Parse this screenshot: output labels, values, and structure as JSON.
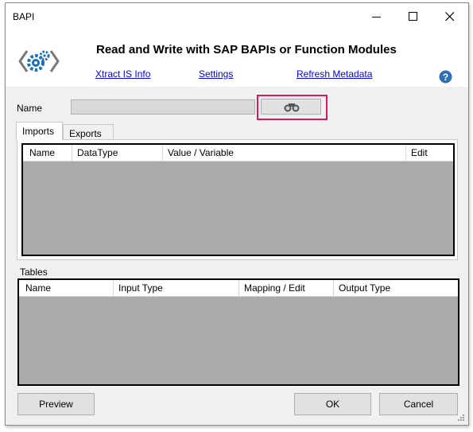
{
  "window": {
    "title": "BAPI"
  },
  "header": {
    "title": "Read and Write with SAP BAPIs or Function Modules",
    "links": {
      "info": "Xtract IS Info",
      "settings": "Settings",
      "refresh": "Refresh Metadata"
    }
  },
  "name_field": {
    "label": "Name",
    "value": ""
  },
  "tabs": [
    {
      "label": "Imports",
      "selected": true
    },
    {
      "label": "Exports",
      "selected": false
    }
  ],
  "imports_grid": {
    "columns": [
      "Name",
      "DataType",
      "Value / Variable",
      "Edit"
    ],
    "rows": []
  },
  "tables_section": {
    "label": "Tables",
    "columns": [
      "Name",
      "Input Type",
      "Mapping / Edit",
      "Output Type"
    ],
    "rows": []
  },
  "buttons": {
    "preview": "Preview",
    "ok": "OK",
    "cancel": "Cancel"
  },
  "colors": {
    "link": "#0000ee",
    "highlight": "#d81b60",
    "grid_bg": "#ababab",
    "icon_blue": "#1a6fb5"
  },
  "icons": [
    "app-gear-icon",
    "help-icon",
    "binoculars-icon",
    "minimize-icon",
    "maximize-icon",
    "close-icon",
    "resize-grip-icon"
  ]
}
